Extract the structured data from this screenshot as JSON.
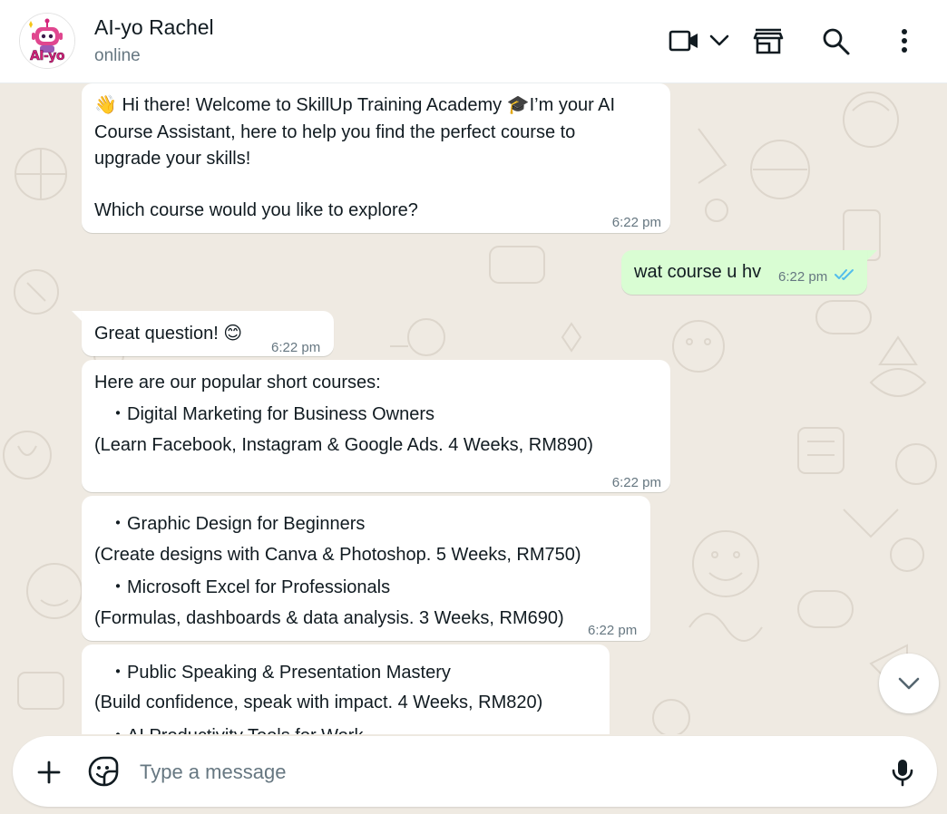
{
  "header": {
    "contact_name": "AI-yo Rachel",
    "status": "online",
    "avatar_text": "AI-yo",
    "icons": [
      "video-call-icon",
      "chevron-down-icon",
      "shop-icon",
      "search-icon",
      "more-options-icon"
    ]
  },
  "messages": [
    {
      "direction": "incoming",
      "lines": [
        "👋 Hi there! Welcome to SkillUp Training Academy 🎓I’m your AI",
        "Course Assistant, here to help you find the perfect course to",
        "upgrade your skills!",
        "",
        "Which course would you like to explore?"
      ],
      "time": "6:22 pm"
    },
    {
      "direction": "outgoing",
      "lines": [
        "wat course u hv"
      ],
      "time": "6:22 pm",
      "read": true
    },
    {
      "direction": "incoming",
      "lines": [
        "Great question! 😊"
      ],
      "time": "6:22 pm"
    },
    {
      "direction": "incoming",
      "lines": [
        "Here are our popular short courses:",
        "・Digital Marketing for Business Owners",
        "(Learn Facebook, Instagram & Google Ads. 4 Weeks, RM890)"
      ],
      "time": "6:22 pm"
    },
    {
      "direction": "incoming",
      "lines": [
        "・Graphic Design for Beginners",
        "(Create designs with Canva & Photoshop. 5 Weeks, RM750)",
        "・Microsoft Excel for Professionals",
        "(Formulas, dashboards & data analysis. 3 Weeks, RM690)"
      ],
      "time": "6:22 pm"
    },
    {
      "direction": "incoming",
      "lines": [
        "・Public Speaking & Presentation Mastery",
        "(Build confidence, speak with impact. 4 Weeks, RM820)",
        "・AI Productivity Tools for Work"
      ]
    }
  ],
  "composer": {
    "placeholder": "Type a message"
  },
  "colors": {
    "chat_bg": "#efeae2",
    "incoming_bubble": "#ffffff",
    "outgoing_bubble": "#d9fdd3",
    "read_ticks": "#53bdeb",
    "avatar_brand": "#d4237a"
  }
}
